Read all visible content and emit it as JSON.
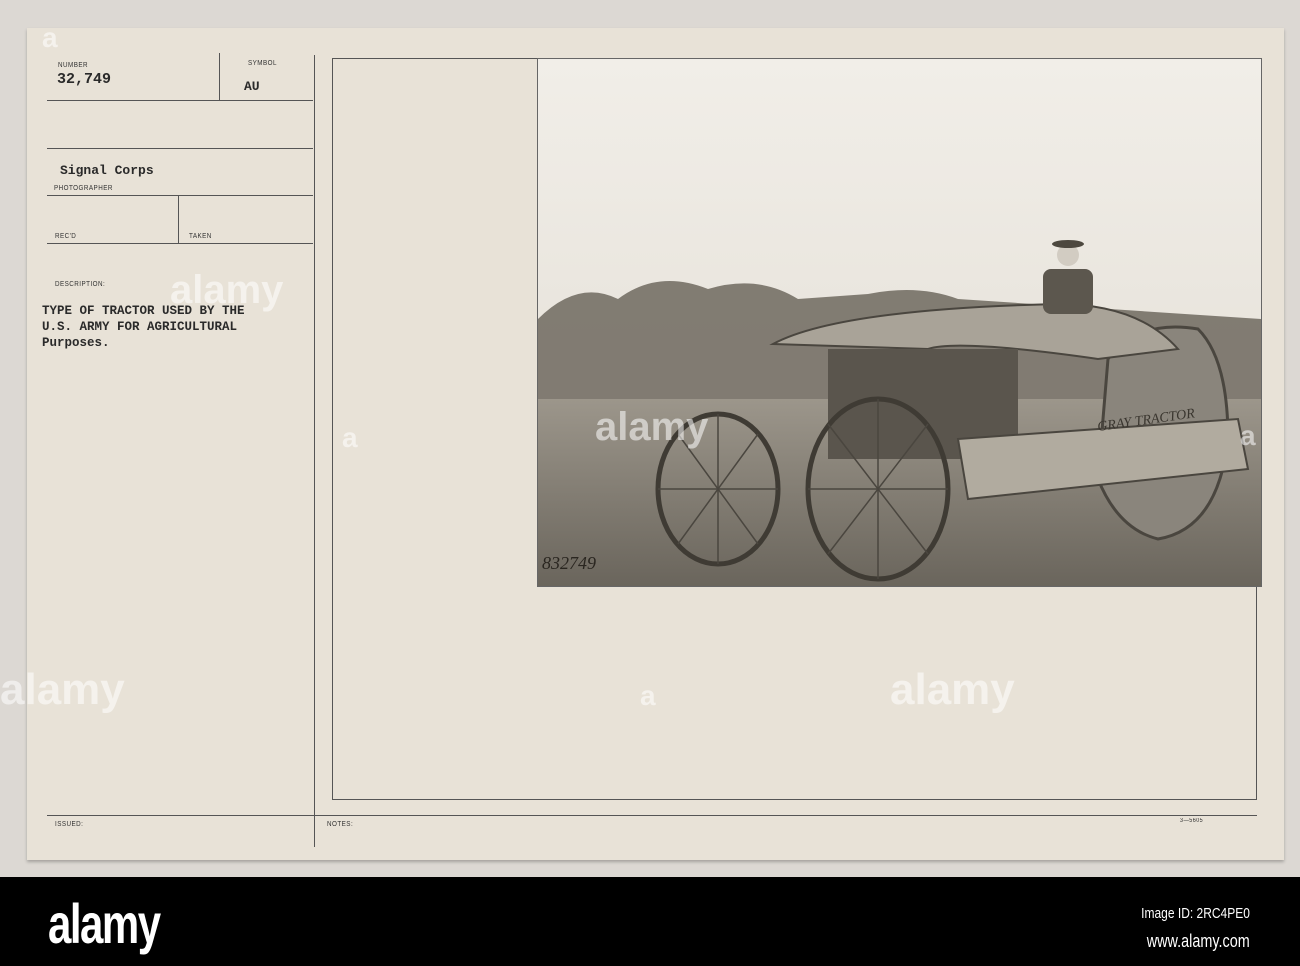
{
  "card": {
    "number_label": "NUMBER",
    "number": "32,749",
    "symbol_label": "SYMBOL",
    "symbol": "AU",
    "photographer": "Signal Corps",
    "photographer_label": "PHOTOGRAPHER",
    "recd_label": "REC'D",
    "taken_label": "TAKEN",
    "description_label": "DESCRIPTION:",
    "description": "TYPE OF TRACTOR USED BY THE\nU.S. ARMY FOR AGRICULTURAL\nPurposes.",
    "issued_label": "ISSUED:",
    "notes_label": "NOTES:",
    "form_number": "3—5605"
  },
  "photo": {
    "negative_number": "832749",
    "tractor_lettering": "GRAY TRACTOR"
  },
  "watermark": {
    "text": "alamy",
    "letter": "a"
  },
  "footer": {
    "logo": "alamy",
    "image_id": "Image ID: 2RC4PE0",
    "url": "www.alamy.com"
  }
}
